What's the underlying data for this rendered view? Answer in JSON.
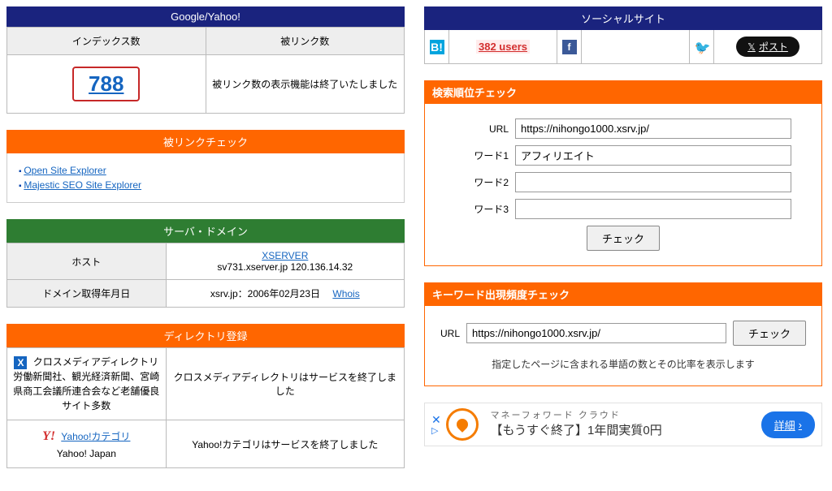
{
  "google_yahoo": {
    "title": "Google/Yahoo!",
    "col_index": "インデックス数",
    "col_backlink": "被リンク数",
    "index_value": "788",
    "backlink_msg": "被リンク数の表示機能は終了いたしました"
  },
  "backlink_check": {
    "title": "被リンクチェック",
    "links": [
      "Open Site Explorer",
      "Majestic SEO Site Explorer"
    ]
  },
  "server": {
    "title": "サーバ・ドメイン",
    "host_label": "ホスト",
    "host_link": "XSERVER",
    "host_detail": "sv731.xserver.jp 120.136.14.32",
    "domain_label": "ドメイン取得年月日",
    "domain_text": "xsrv.jp：2006年02月23日　",
    "whois": "Whois"
  },
  "directory": {
    "title": "ディレクトリ登録",
    "cross_title": "クロスメディアディレクトリ",
    "cross_sub": "労働新聞社、観光経済新聞、宮崎県商工会議所連合会など老舗優良サイト多数",
    "cross_msg": "クロスメディアディレクトリはサービスを終了しました",
    "yahoo_link": "Yahoo!カテゴリ",
    "yahoo_sub": "Yahoo! Japan",
    "yahoo_msg": "Yahoo!カテゴリはサービスを終了しました"
  },
  "social": {
    "title": "ソーシャルサイト",
    "hatena_users": "382 users",
    "x_post": "ポスト"
  },
  "rank_check": {
    "title": "検索順位チェック",
    "url_label": "URL",
    "url_value": "https://nihongo1000.xsrv.jp/",
    "word1_label": "ワード1",
    "word1_value": "アフィリエイト",
    "word2_label": "ワード2",
    "word3_label": "ワード3",
    "button": "チェック"
  },
  "keyword_freq": {
    "title": "キーワード出現頻度チェック",
    "url_label": "URL",
    "url_value": "https://nihongo1000.xsrv.jp/",
    "button": "チェック",
    "note": "指定したページに含まれる単語の数とその比率を表示します"
  },
  "ad": {
    "sub": "マネーフォワード クラウド",
    "main": "【もうすぐ終了】1年間実質0円",
    "button": "詳細"
  }
}
